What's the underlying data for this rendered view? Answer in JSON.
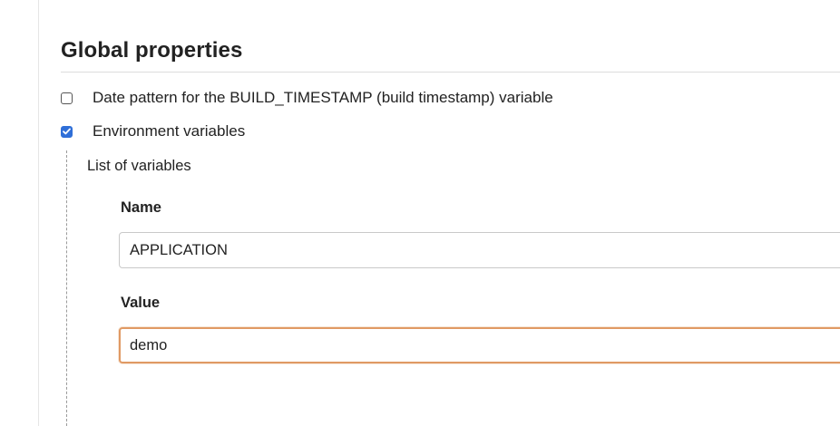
{
  "section": {
    "title": "Global properties"
  },
  "options": {
    "date_pattern": {
      "label": "Date pattern for the BUILD_TIMESTAMP (build timestamp) variable",
      "checked": false
    },
    "environment_variables": {
      "label": "Environment variables",
      "checked": true
    }
  },
  "env_vars": {
    "list_label": "List of variables",
    "name_label": "Name",
    "name_value": "APPLICATION",
    "value_label": "Value",
    "value_value": "demo"
  },
  "colors": {
    "checkbox_checked": "#2f6fd8",
    "focused_input_border": "#e09a64"
  }
}
